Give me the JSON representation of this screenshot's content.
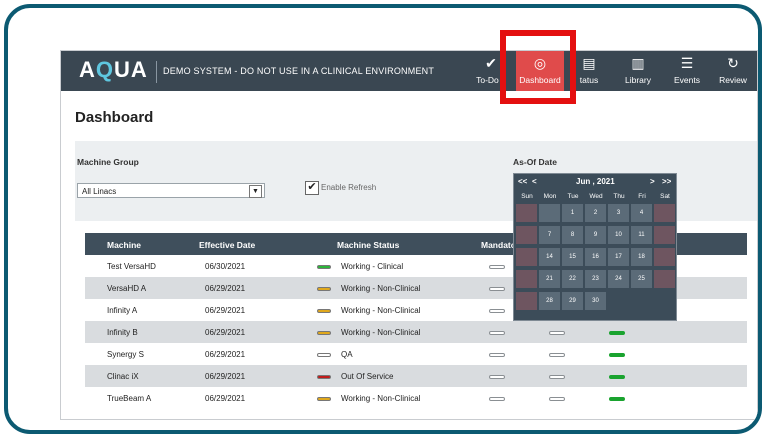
{
  "app": {
    "logo_a": "A",
    "logo_q": "Q",
    "logo_rest": "UA",
    "banner": "DEMO SYSTEM - DO NOT USE IN A CLINICAL ENVIRONMENT"
  },
  "nav": [
    {
      "label": "To-Do L",
      "icon": "checkmark-icon"
    },
    {
      "label": "Dashboard",
      "icon": "dashboard-icon"
    },
    {
      "label": "tatus",
      "icon": "document-icon"
    },
    {
      "label": "Library",
      "icon": "book-icon"
    },
    {
      "label": "Events",
      "icon": "list-icon"
    },
    {
      "label": "Review",
      "icon": "refresh-icon"
    }
  ],
  "page": {
    "title": "Dashboard"
  },
  "filters": {
    "machine_group_label": "Machine Group",
    "machine_group_value": "All Linacs",
    "enable_refresh_label": "Enable Refresh",
    "as_of_date_label": "As-Of Date"
  },
  "table": {
    "headers": [
      "Machine",
      "Effective Date",
      "Machine Status",
      "Mandatory"
    ],
    "rows": [
      {
        "machine": "Test VersaHD",
        "date": "06/30/2021",
        "status": "Working - Clinical",
        "color": "#2cb53a"
      },
      {
        "machine": "VersaHD A",
        "date": "06/29/2021",
        "status": "Working - Non-Clinical",
        "color": "#e0a81c"
      },
      {
        "machine": "Infinity A",
        "date": "06/29/2021",
        "status": "Working - Non-Clinical",
        "color": "#e0a81c"
      },
      {
        "machine": "Infinity B",
        "date": "06/29/2021",
        "status": "Working - Non-Clinical",
        "color": "#e0a81c"
      },
      {
        "machine": "Synergy S",
        "date": "06/29/2021",
        "status": "QA",
        "color": "#ffffff"
      },
      {
        "machine": "Clinac iX",
        "date": "06/29/2021",
        "status": "Out Of Service",
        "color": "#c01c1c"
      },
      {
        "machine": "TrueBeam A",
        "date": "06/29/2021",
        "status": "Working - Non-Clinical",
        "color": "#e0a81c"
      }
    ]
  },
  "calendar": {
    "prev_year": "<<",
    "prev_month": "<",
    "month_label": "Jun , 2021",
    "next_month": ">",
    "next_year": ">>",
    "day_names": [
      "Sun",
      "Mon",
      "Tue",
      "Wed",
      "Thu",
      "Fri",
      "Sat"
    ],
    "weeks": [
      [
        "",
        "",
        "1",
        "2",
        "3",
        "4",
        ""
      ],
      [
        "",
        "7",
        "8",
        "9",
        "10",
        "11",
        ""
      ],
      [
        "",
        "14",
        "15",
        "16",
        "17",
        "18",
        ""
      ],
      [
        "",
        "21",
        "22",
        "23",
        "24",
        "25",
        ""
      ],
      [
        "",
        "28",
        "29",
        "30",
        "",
        "",
        ""
      ]
    ]
  },
  "colors": {
    "header": "#3a4752",
    "active": "#e04b4b",
    "highlight": "#e41010"
  }
}
